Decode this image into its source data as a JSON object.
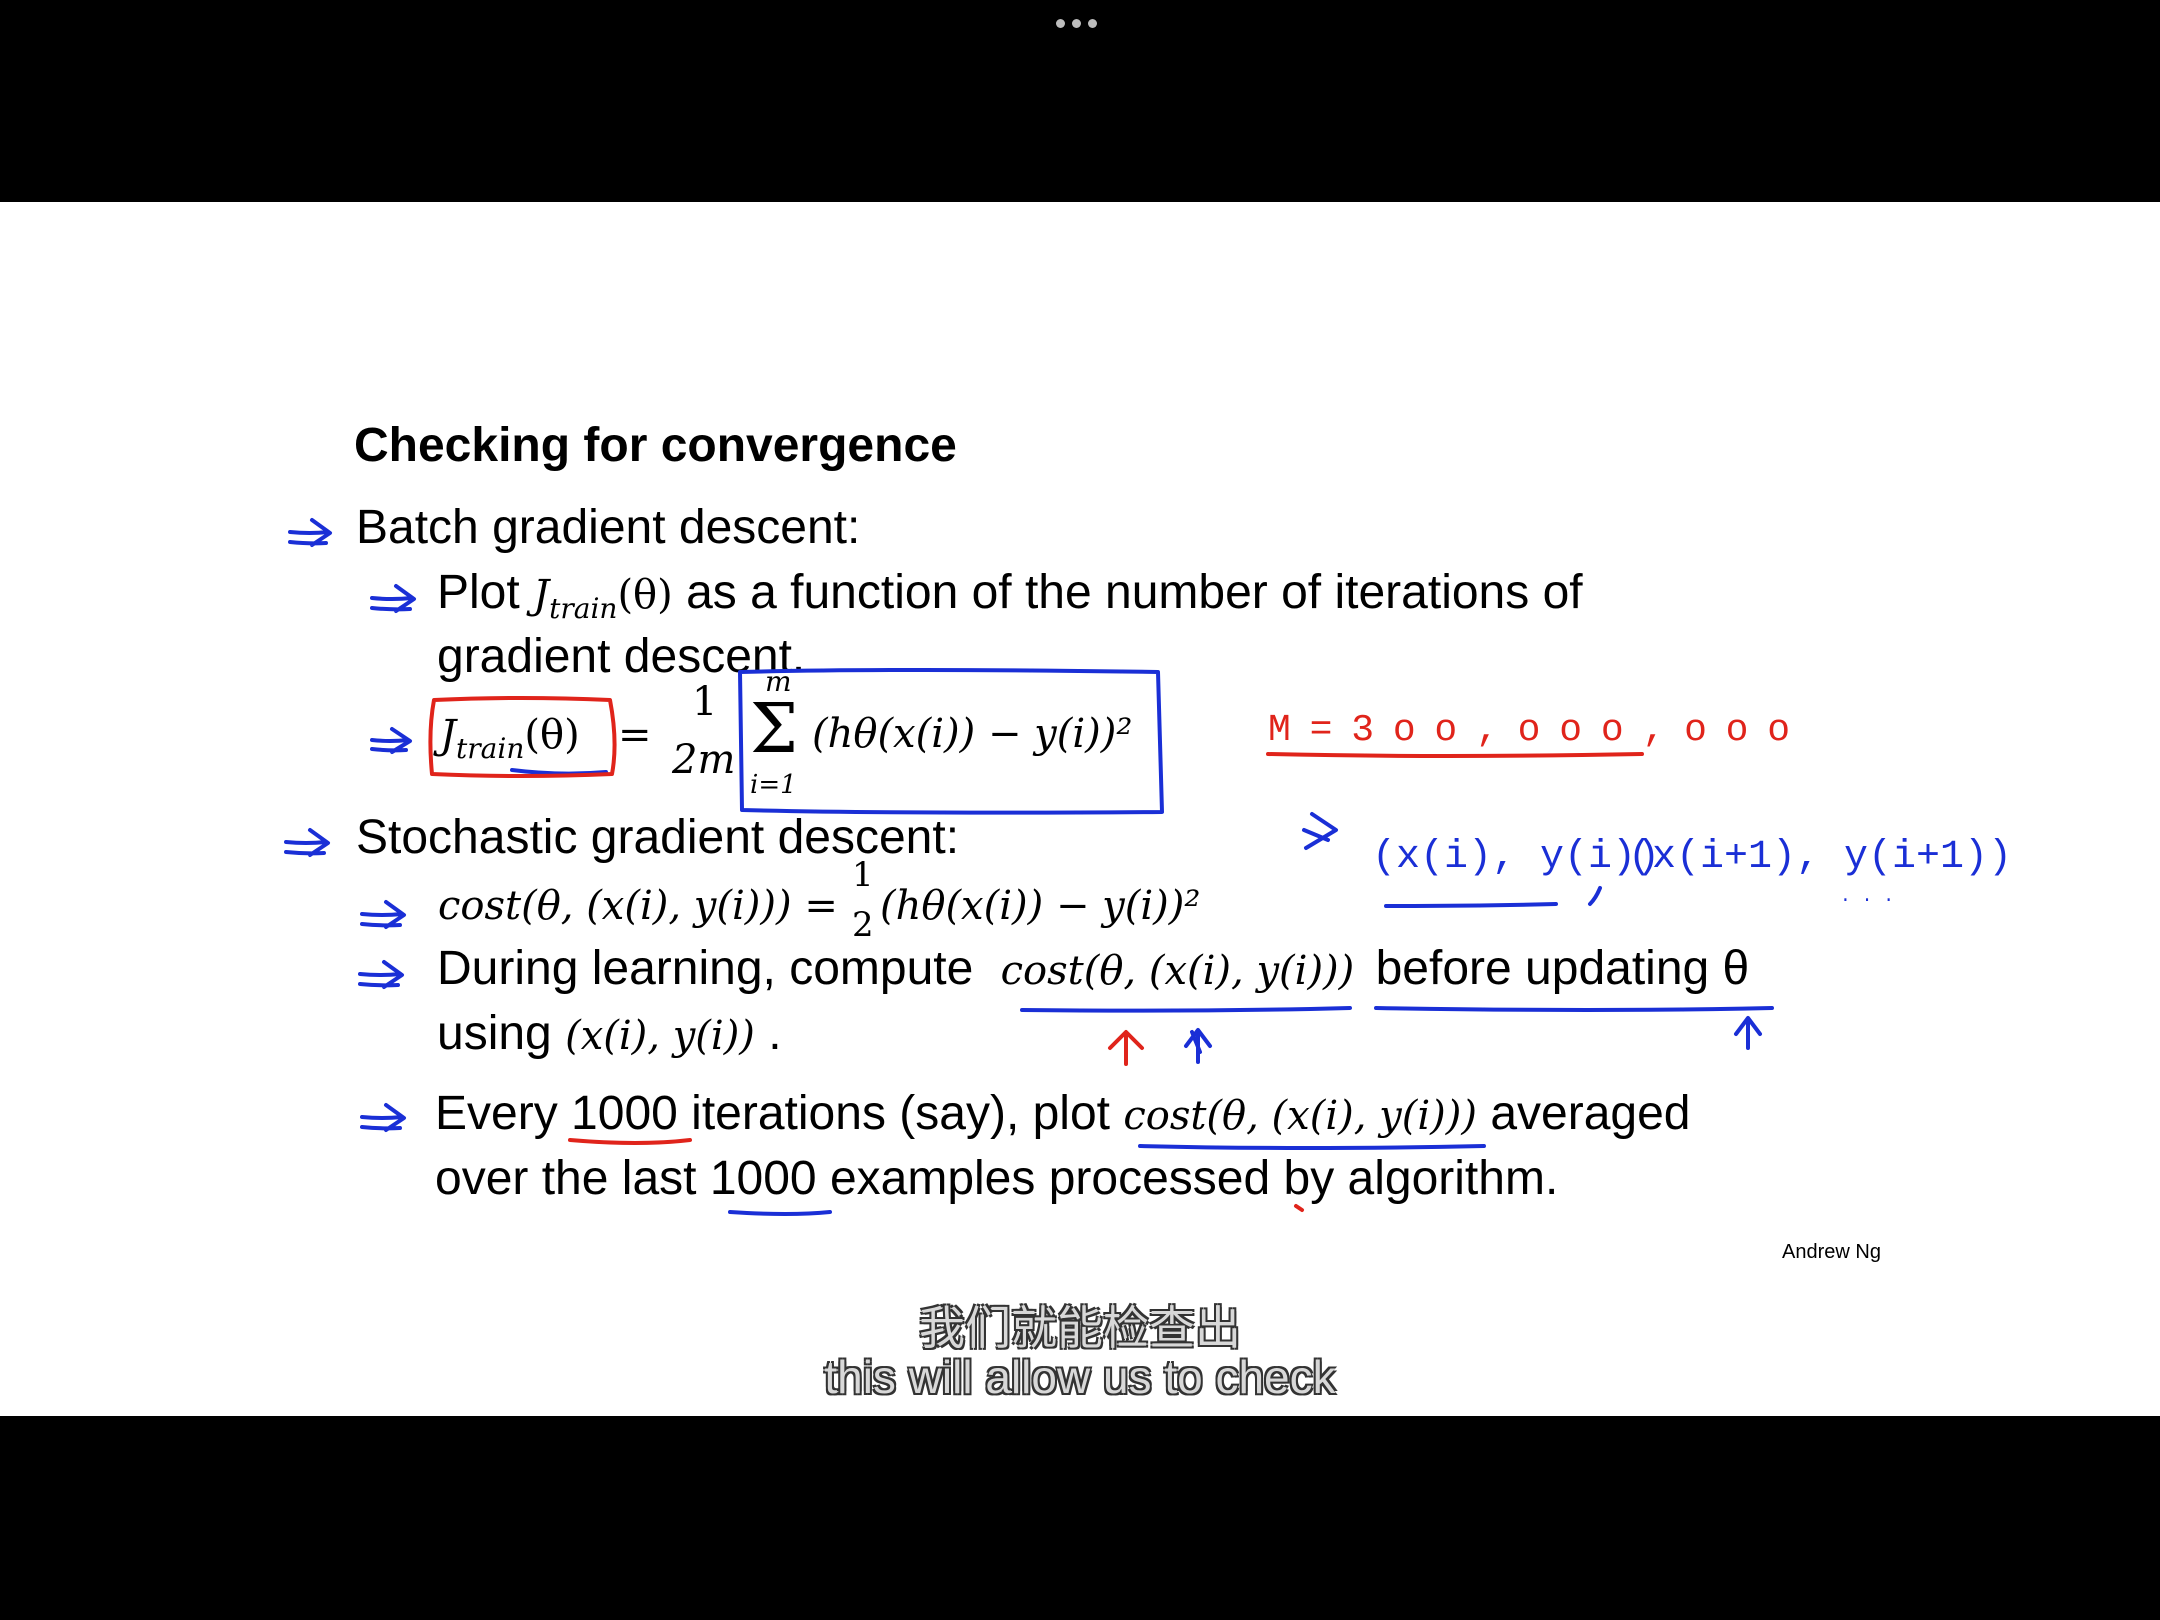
{
  "window": {
    "menu_icon": "more-dots-icon"
  },
  "slide": {
    "title": "Checking for convergence",
    "batch": {
      "heading": "Batch gradient descent:",
      "plot_prefix": "Plot",
      "plot_J": "J",
      "plot_sub": "train",
      "plot_arg": "(θ)",
      "plot_suffix": "as a function of the number of iterations of",
      "plot_line2": "gradient descent.",
      "formula_lhs": "J",
      "formula_lhs_sub": "train",
      "formula_lhs_arg": "(θ)",
      "formula_eq": "=",
      "frac_num": "1",
      "frac_den": "2m",
      "sum_top": "m",
      "sum_symbol": "Σ",
      "sum_bottom": "i=1",
      "sum_body": "(hθ(x(i)) − y(i))²"
    },
    "stochastic": {
      "heading": "Stochastic gradient descent:",
      "cost_formula": "cost(θ, (x(i), y(i))) =",
      "cost_frac_num": "1",
      "cost_frac_den": "2",
      "cost_rhs": "(hθ(x(i)) − y(i))²",
      "during_prefix": "During learning, compute",
      "during_math": "cost(θ, (x(i), y(i)))",
      "during_suffix": "before updating θ",
      "using_prefix": "using",
      "using_math": "(x(i), y(i))",
      "using_end": ".",
      "every_prefix": "Every",
      "every_num": "1000",
      "every_mid": "iterations (say), plot",
      "every_math": "cost(θ, (x(i), y(i)))",
      "every_suffix": "averaged",
      "over_prefix": "over the last",
      "over_num": "1000",
      "over_suffix": "examples processed by algorithm."
    },
    "annotations": {
      "m_value": "M = 3 o o ,  o o o ,  o o o",
      "pair_1": "(x(i), y(i))",
      "pair_2": "(x(i+1), y(i+1))",
      "ellipsis": ". . ."
    },
    "author": "Andrew Ng"
  },
  "subtitles": {
    "line_zh": "我们就能检查出",
    "line_en": "this will allow us to check"
  },
  "colors": {
    "ink_blue": "#1a2fd6",
    "ink_red": "#e0241b",
    "slide_bg": "#ffffff",
    "frame_bg": "#000000"
  }
}
